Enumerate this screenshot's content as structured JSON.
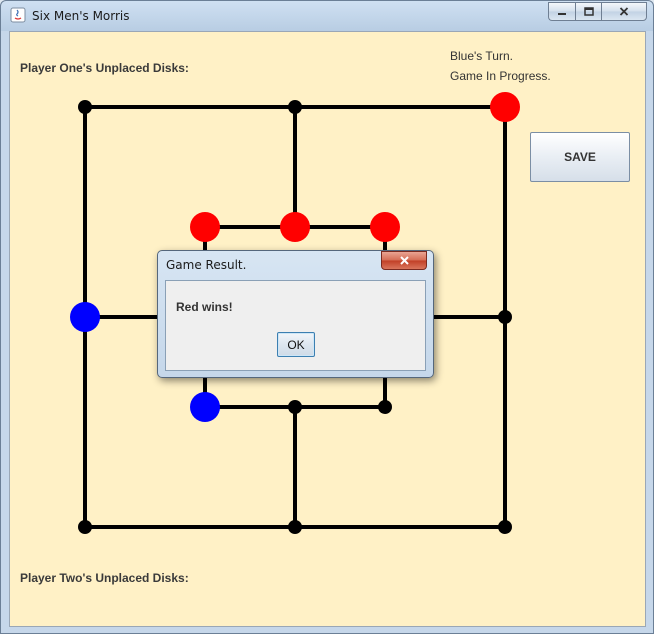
{
  "window": {
    "title": "Six Men's Morris"
  },
  "labels": {
    "player_one_unplaced": "Player One's Unplaced Disks:",
    "player_two_unplaced": "Player Two's Unplaced Disks:",
    "turn_status": "Blue's Turn.",
    "game_status": "Game In Progress."
  },
  "buttons": {
    "save": "SAVE"
  },
  "dialog": {
    "title": "Game Result.",
    "message": "Red wins!",
    "ok": "OK"
  },
  "board": {
    "colors": {
      "red": "#ff0000",
      "blue": "#0000ff",
      "empty": "#000000",
      "lines": "#000000",
      "background": "#fff1c6"
    },
    "points": [
      {
        "id": "outer-top-left",
        "state": "empty"
      },
      {
        "id": "outer-top-middle",
        "state": "empty"
      },
      {
        "id": "outer-top-right",
        "state": "red"
      },
      {
        "id": "outer-middle-left",
        "state": "blue"
      },
      {
        "id": "outer-middle-right",
        "state": "empty"
      },
      {
        "id": "outer-bottom-left",
        "state": "empty"
      },
      {
        "id": "outer-bottom-middle",
        "state": "empty"
      },
      {
        "id": "outer-bottom-right",
        "state": "empty"
      },
      {
        "id": "inner-top-left",
        "state": "red"
      },
      {
        "id": "inner-top-middle",
        "state": "red"
      },
      {
        "id": "inner-top-right",
        "state": "red"
      },
      {
        "id": "inner-middle-left",
        "state": "empty"
      },
      {
        "id": "inner-middle-right",
        "state": "empty"
      },
      {
        "id": "inner-bottom-left",
        "state": "blue"
      },
      {
        "id": "inner-bottom-middle",
        "state": "empty"
      },
      {
        "id": "inner-bottom-right",
        "state": "empty"
      }
    ]
  }
}
